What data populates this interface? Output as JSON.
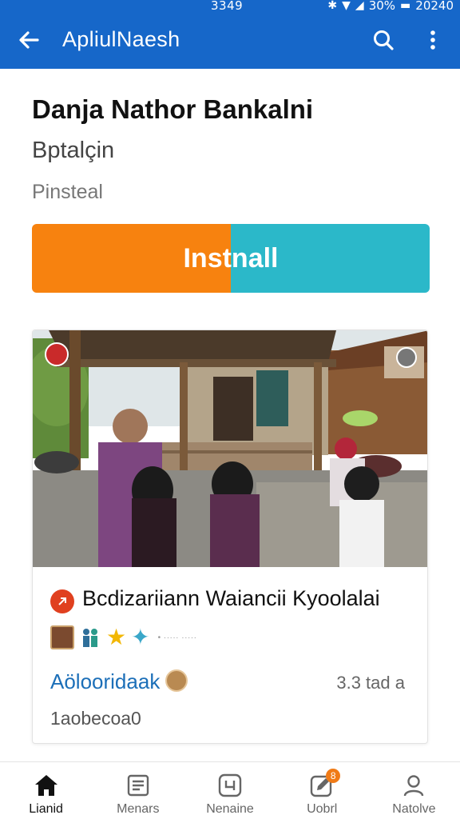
{
  "status_bar": {
    "time": "3349",
    "battery": "30%",
    "clock": "20240"
  },
  "app_bar": {
    "title": "ApliulNaesh"
  },
  "app": {
    "name": "Danja Nathor Bankalni",
    "developer": "Bptalçin",
    "status": "Pinsteal",
    "install_label": "Instnall"
  },
  "card": {
    "title": "Bcdizariiann Waiancii Kyoolalai",
    "rating_text": "• ····· ·····",
    "author": "Aölooridaak",
    "size": "3.3 tad a",
    "date": "1aobecoa0"
  },
  "bottom_nav": {
    "items": [
      {
        "label": "Lianid",
        "icon": "home-icon"
      },
      {
        "label": "Menars",
        "icon": "list-icon"
      },
      {
        "label": "Nenaine",
        "icon": "calendar-icon"
      },
      {
        "label": "Uobrl",
        "icon": "edit-icon",
        "badge": "8"
      },
      {
        "label": "Natolve",
        "icon": "person-icon"
      }
    ]
  },
  "colors": {
    "primary": "#1667c9",
    "install_left": "#f7820f",
    "install_right": "#2bb8c9",
    "link": "#1c6fb8"
  }
}
